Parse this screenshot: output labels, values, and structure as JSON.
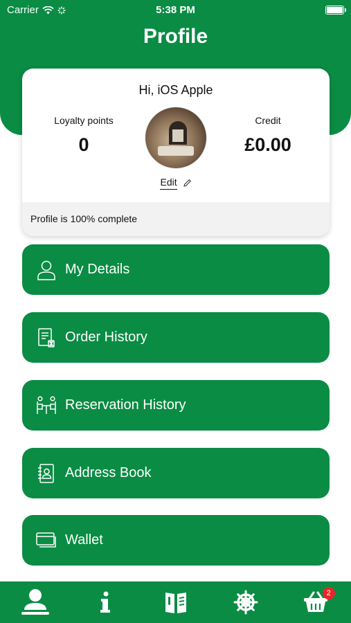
{
  "status_bar": {
    "carrier": "Carrier",
    "time": "5:38 PM"
  },
  "header": {
    "title": "Profile"
  },
  "profile": {
    "greeting": "Hi, iOS Apple",
    "loyalty_label": "Loyalty points",
    "loyalty_value": "0",
    "credit_label": "Credit",
    "credit_value": "£0.00",
    "edit_label": "Edit",
    "completion_text": "Profile is 100% complete"
  },
  "menu": {
    "my_details": "My Details",
    "order_history": "Order History",
    "reservation_history": "Reservation History",
    "address_book": "Address Book",
    "wallet": "Wallet"
  },
  "tab_bar": {
    "basket_count": "2"
  },
  "colors": {
    "brand_green": "#0a8c44",
    "badge_red": "#e8262b"
  }
}
